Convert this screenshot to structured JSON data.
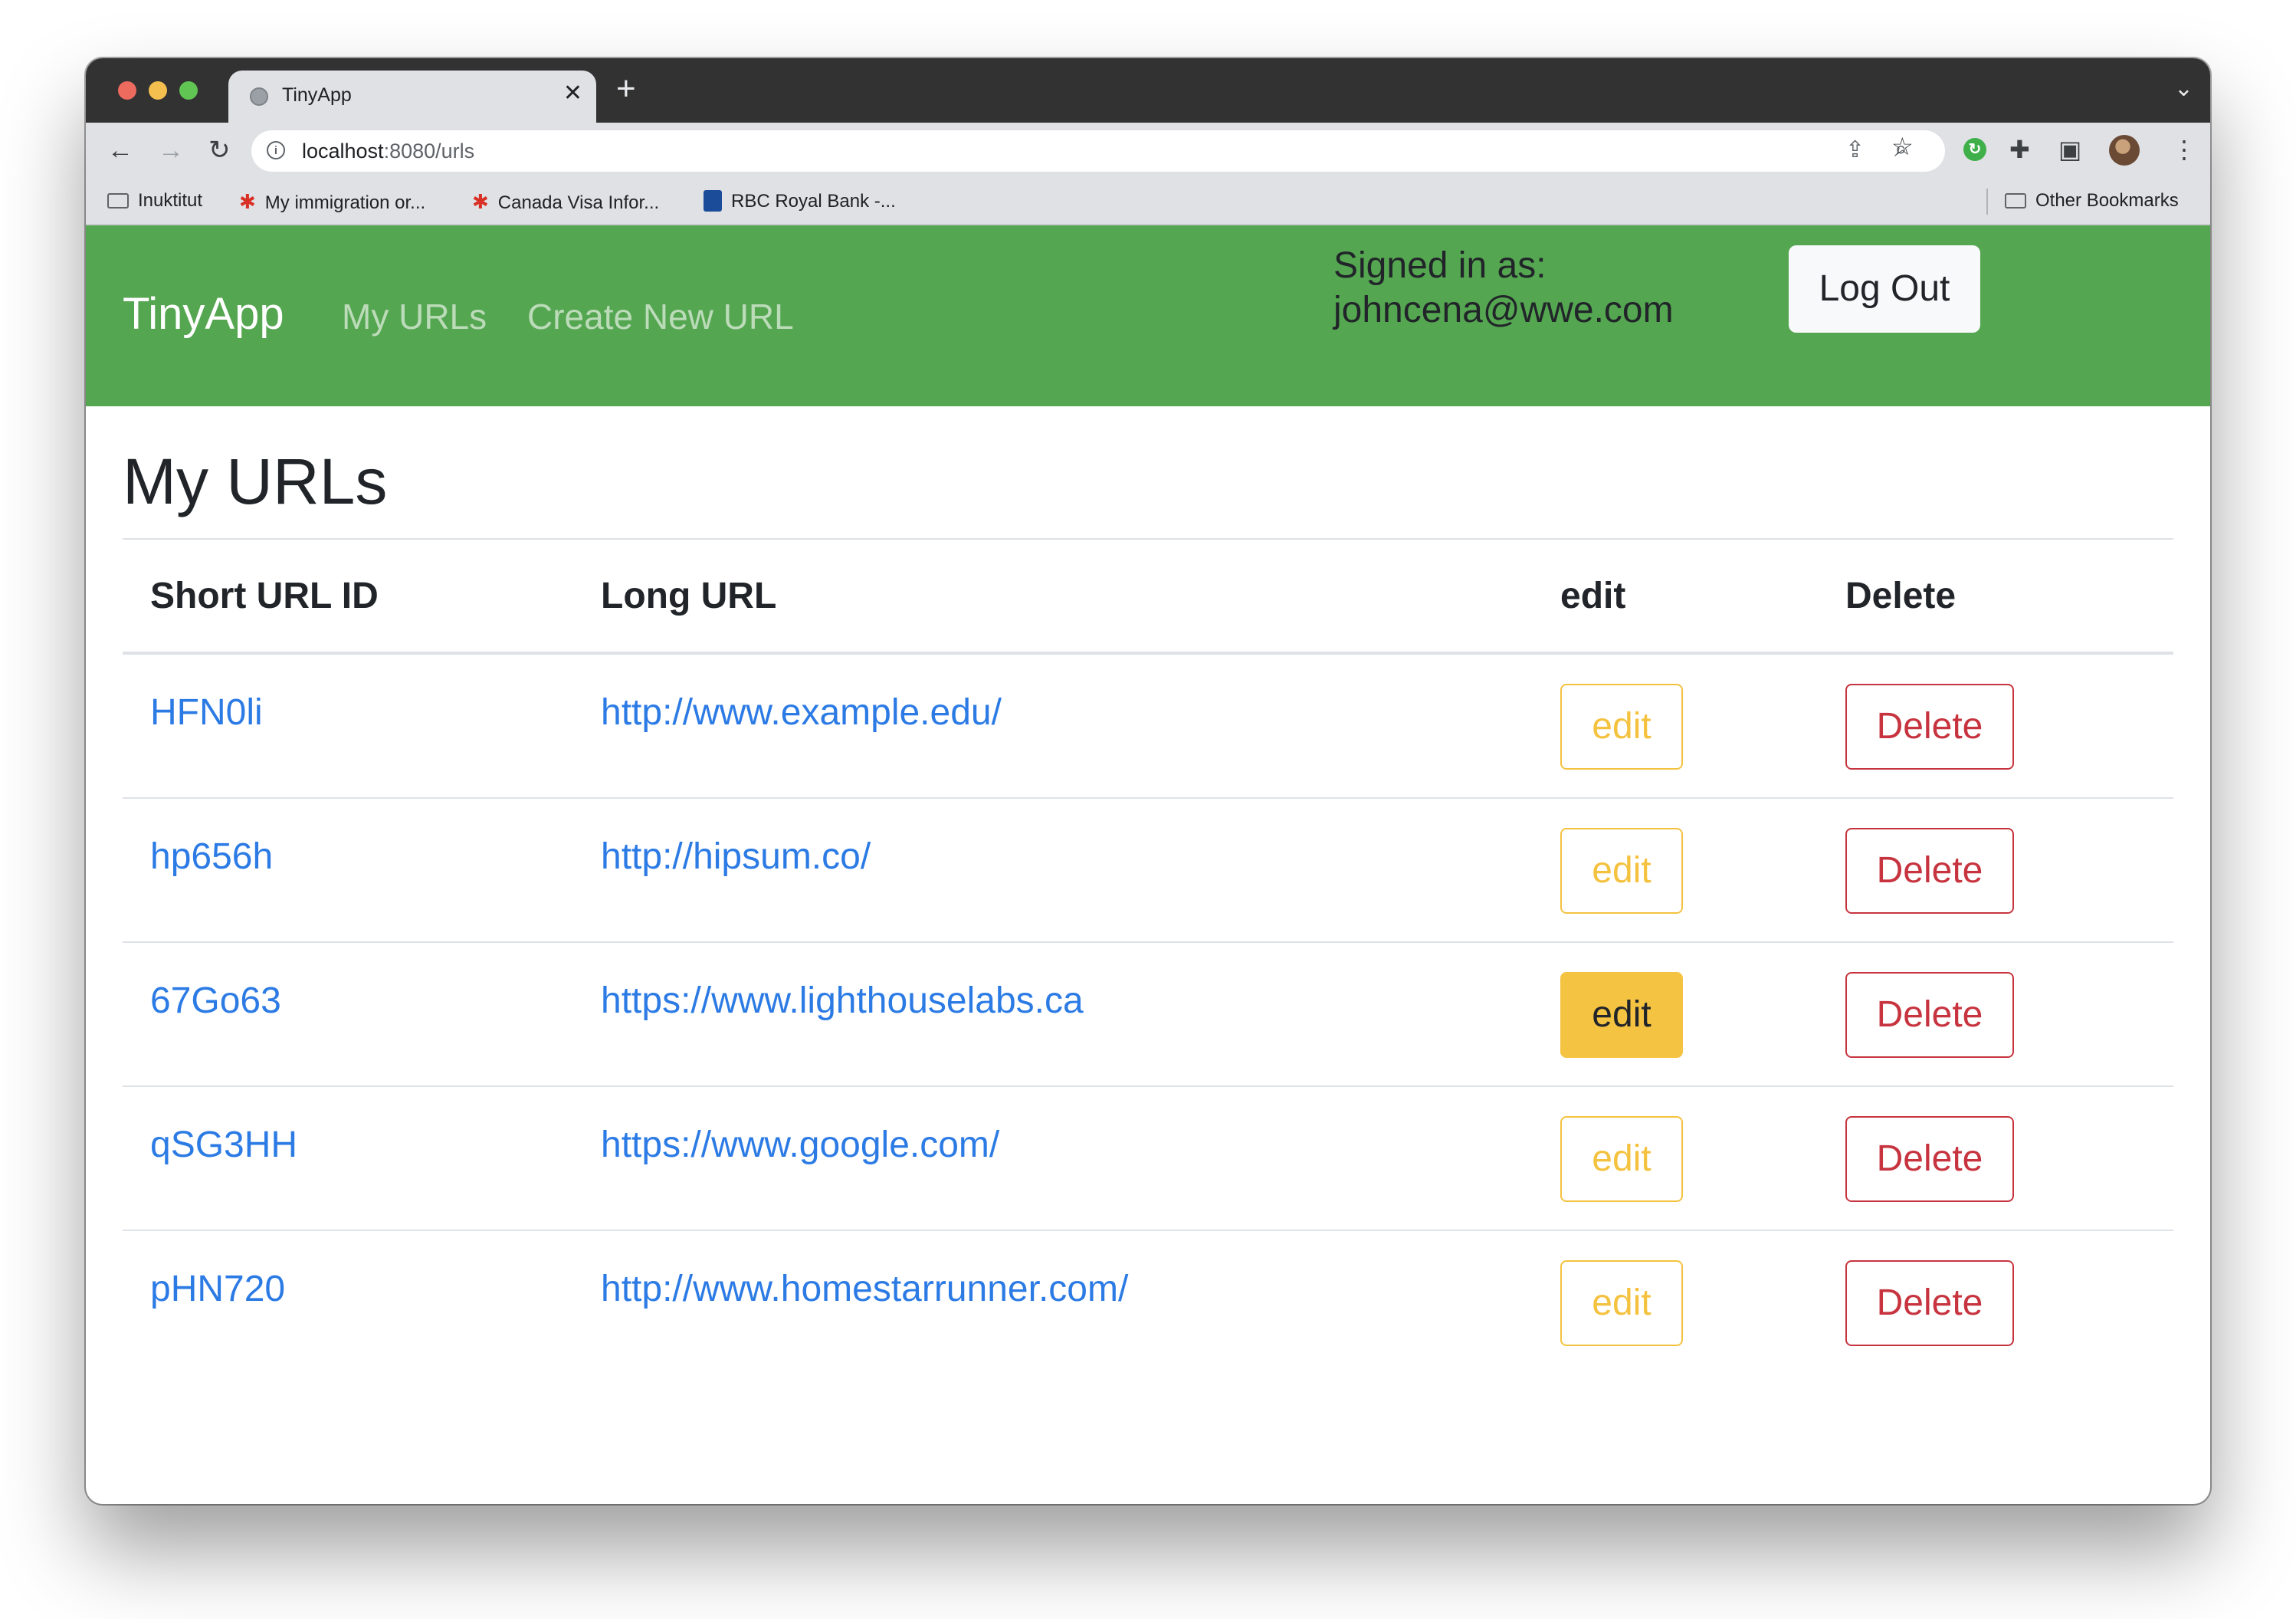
{
  "browser": {
    "tab_title": "TinyApp",
    "url_host": "localhost",
    "url_path": ":8080/urls",
    "bookmarks": [
      "Inuktitut",
      "My immigration or...",
      "Canada Visa Infor...",
      "RBC Royal Bank -..."
    ],
    "other_bookmarks": "Other Bookmarks"
  },
  "navbar": {
    "brand": "TinyApp",
    "links": [
      "My URLs",
      "Create New URL"
    ],
    "signed_in_label": "Signed in as:",
    "signed_in_email": "johncena@wwe.com",
    "logout_label": "Log Out"
  },
  "main": {
    "title": "My URLs",
    "columns": [
      "Short URL ID",
      "Long URL",
      "edit",
      "Delete"
    ],
    "rows": [
      {
        "short": "HFN0li",
        "long": "http://www.example.edu/",
        "edit": "edit",
        "delete": "Delete"
      },
      {
        "short": "hp656h",
        "long": "http://hipsum.co/",
        "edit": "edit",
        "delete": "Delete"
      },
      {
        "short": "67Go63",
        "long": "https://www.lighthouselabs.ca",
        "edit": "edit",
        "delete": "Delete"
      },
      {
        "short": "qSG3HH",
        "long": "https://www.google.com/",
        "edit": "edit",
        "delete": "Delete"
      },
      {
        "short": "pHN720",
        "long": "http://www.homestarrunner.com/",
        "edit": "edit",
        "delete": "Delete"
      }
    ]
  },
  "colors": {
    "navbar_bg": "#55a651",
    "link": "#2c7be5",
    "edit_outline": "#f4c23f",
    "delete_outline": "#c7343f"
  },
  "icons": [
    "back-icon",
    "forward-icon",
    "reload-icon",
    "info-icon",
    "zoom-icon",
    "share-icon",
    "star-icon",
    "extension-icon",
    "puzzle-icon",
    "sidepanel-icon",
    "menu-icon",
    "folder-icon",
    "maple-leaf-icon",
    "rbc-icon"
  ]
}
